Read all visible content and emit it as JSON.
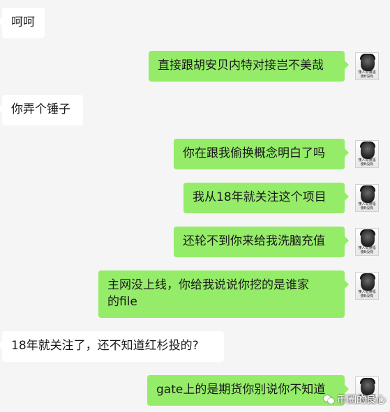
{
  "messages": [
    {
      "side": "left",
      "text": "呵呵"
    },
    {
      "side": "right",
      "text": "直接跟胡安贝内特对接岂不美哉"
    },
    {
      "side": "left",
      "text": "你弄个锤子"
    },
    {
      "side": "right",
      "text": "你在跟我偷换概念明白了吗"
    },
    {
      "side": "right",
      "text": "我从18年就关注这个项目"
    },
    {
      "side": "right",
      "text": "还轮不到你来给我洗脑充值"
    },
    {
      "side": "right",
      "text": "主网没上线，你给我说说你挖的是谁家的file"
    },
    {
      "side": "left",
      "text": "18年就关注了，还不知道红杉投的?"
    },
    {
      "side": "right",
      "text": "gate上的是期货你别说你不知道"
    }
  ],
  "avatar": {
    "caption": "懂人有懂福\n傻B没有"
  },
  "watermark": {
    "text": "币圈的良心"
  },
  "colors": {
    "sent_bubble": "#95ec69",
    "received_bubble": "#ffffff",
    "background": "#f5f5f5"
  }
}
